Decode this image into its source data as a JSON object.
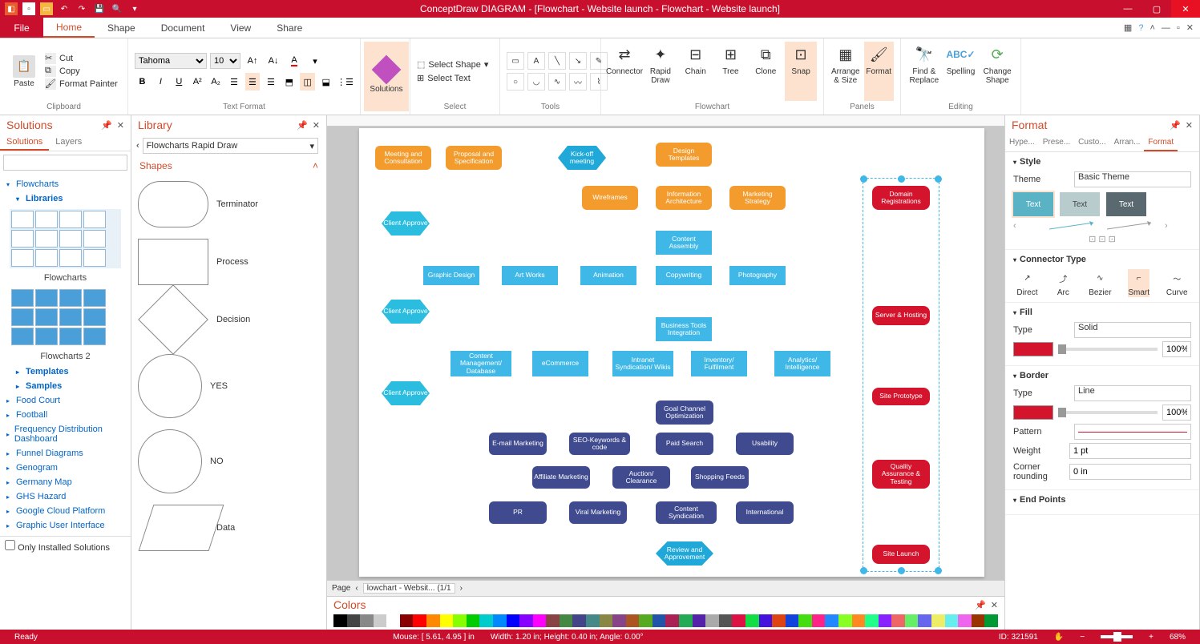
{
  "titlebar": {
    "title": "ConceptDraw DIAGRAM - [Flowchart - Website launch - Flowchart - Website launch]"
  },
  "tabs": {
    "file": "File",
    "home": "Home",
    "shape": "Shape",
    "document": "Document",
    "view": "View",
    "share": "Share"
  },
  "ribbon": {
    "paste": "Paste",
    "cut": "Cut",
    "copy": "Copy",
    "format_painter": "Format Painter",
    "clipboard": "Clipboard",
    "font": "Tahoma",
    "size": "10",
    "text_format": "Text Format",
    "solutions": "Solutions",
    "select_shape": "Select Shape",
    "select_text": "Select Text",
    "select": "Select",
    "tools": "Tools",
    "connector": "Connector",
    "rapid_draw": "Rapid Draw",
    "chain": "Chain",
    "tree": "Tree",
    "clone": "Clone",
    "snap": "Snap",
    "flowchart": "Flowchart",
    "arrange_size": "Arrange & Size",
    "format": "Format",
    "panels": "Panels",
    "find_replace": "Find & Replace",
    "spelling": "Spelling",
    "change_shape": "Change Shape",
    "editing": "Editing"
  },
  "solutions_panel": {
    "title": "Solutions",
    "tab_solutions": "Solutions",
    "tab_layers": "Layers",
    "tree": [
      "Flowcharts",
      "Libraries",
      "Flowcharts",
      "Flowcharts 2",
      "Templates",
      "Samples",
      "Food Court",
      "Football",
      "Frequency Distribution Dashboard",
      "Funnel Diagrams",
      "Genogram",
      "Germany Map",
      "GHS Hazard",
      "Google Cloud Platform",
      "Graphic User Interface"
    ],
    "checkbox": "Only Installed Solutions"
  },
  "library_panel": {
    "title": "Library",
    "shapes_label": "Shapes",
    "dropdown": "Flowcharts Rapid Draw",
    "shapes": [
      "Terminator",
      "Process",
      "Decision",
      "YES",
      "NO",
      "Data"
    ]
  },
  "canvas": {
    "shapes": {
      "meeting": "Meeting and Consultation",
      "proposal": "Proposal and Specification",
      "kickoff": "Kick-off meeting",
      "design_templates": "Design Templates",
      "client_approve": "Client Approve",
      "wireframes": "Wireframes",
      "info_arch": "Information Architecture",
      "marketing": "Marketing Strategy",
      "domain_reg": "Domain Registrations",
      "content_assembly": "Content Assembly",
      "graphic_design": "Graphic Design",
      "art_works": "Art Works",
      "animation": "Animation",
      "copywriting": "Copywriting",
      "photography": "Photography",
      "server_hosting": "Server & Hosting",
      "business_tools": "Business Tools Integration",
      "content_mgmt": "Content Management/ Database",
      "ecommerce": "eCommerce",
      "intranet": "Intranet Syndication/ Wikis",
      "inventory": "Inventory/ Fulfilment",
      "analytics": "Analytics/ Intelligence",
      "site_prototype": "Site Prototype",
      "goal_channel": "Goal Channel Optimization",
      "email_mkt": "E-mail Marketing",
      "seo": "SEO-Keywords & code",
      "paid_search": "Paid Search",
      "usability": "Usability",
      "affiliate": "Affiliate Marketing",
      "auction": "Auction/ Clearance",
      "shopping": "Shopping Feeds",
      "qa": "Quality Assurance & Testing",
      "pr": "PR",
      "viral": "Viral Marketing",
      "content_synd": "Content Syndication",
      "international": "International",
      "review": "Review and Approvement",
      "site_launch": "Site Launch"
    },
    "page_label": "Page",
    "page_tab": "lowchart - Websit... (1/1"
  },
  "colors": {
    "title": "Colors"
  },
  "format": {
    "title": "Format",
    "tabs": [
      "Hype...",
      "Prese...",
      "Custo...",
      "Arran...",
      "Format"
    ],
    "style": "Style",
    "theme_label": "Theme",
    "theme_value": "Basic Theme",
    "text_btn": "Text",
    "connector_type": "Connector Type",
    "conn": [
      "Direct",
      "Arc",
      "Bezier",
      "Smart",
      "Curve"
    ],
    "fill": "Fill",
    "type_label": "Type",
    "fill_type": "Solid",
    "fill_pct": "100%",
    "border": "Border",
    "border_type": "Line",
    "border_pct": "100%",
    "pattern": "Pattern",
    "weight": "Weight",
    "weight_val": "1 pt",
    "corner": "Corner rounding",
    "corner_val": "0 in",
    "end_points": "End Points"
  },
  "status": {
    "ready": "Ready",
    "mouse": "Mouse: [ 5.61, 4.95 ] in",
    "dims": "Width: 1.20 in;   Height: 0.40 in;   Angle: 0.00°",
    "id": "ID: 321591",
    "zoom": "68%"
  }
}
